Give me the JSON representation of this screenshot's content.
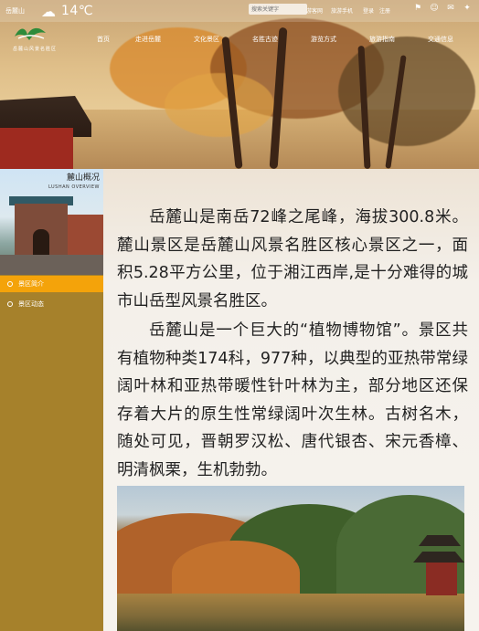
{
  "header": {
    "city": "岳麓山",
    "temperature": "14℃",
    "weather_icon": "cloud-icon",
    "search_placeholder": "搜索关键字",
    "top_links": [
      "游客网",
      "旅游手机",
      "登录",
      "注册"
    ],
    "logo_text": "岳麓山风景名胜区"
  },
  "nav": {
    "items": [
      "首页",
      "走进岳麓",
      "文化景区",
      "名胜古迹",
      "游览方式",
      "旅游指南",
      "交通信息"
    ]
  },
  "sidebar": {
    "banner_title": "麓山概况",
    "banner_subtitle": "LUSHAN OVERVIEW",
    "items": [
      {
        "label": "景区简介",
        "active": true
      },
      {
        "label": "景区动态",
        "active": false
      }
    ]
  },
  "article": {
    "paragraphs": [
      "岳麓山是南岳72峰之尾峰，海拔300.8米。麓山景区是岳麓山风景名胜区核心景区之一，面积5.28平方公里，位于湘江西岸,是十分难得的城市山岳型风景名胜区。",
      "岳麓山是一个巨大的“植物博物馆”。景区共有植物种类174科，977种，以典型的亚热带常绿阔叶林和亚热带暖性针叶林为主，部分地区还保存着大片的原生性常绿阔叶次生林。古树名木，随处可见，晋朝罗汉松、唐代银杏、宋元香樟、明清枫栗，生机勃勃。"
    ]
  },
  "colors": {
    "sidebar_bg": "#a6812b",
    "active_item": "#f4a30a",
    "content_bg": "#f6f3ee"
  }
}
